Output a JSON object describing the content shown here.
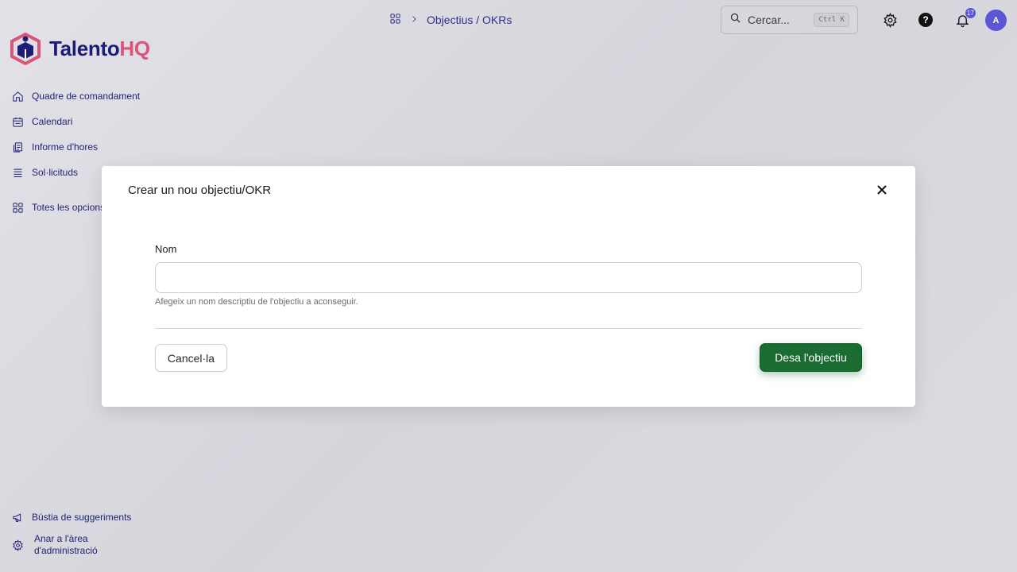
{
  "app": {
    "logo_part1": "Talento",
    "logo_part2": "HQ"
  },
  "breadcrumb": {
    "current": "Objectius / OKRs"
  },
  "search": {
    "placeholder": "Cercar...",
    "shortcut": "Ctrl K"
  },
  "notifications": {
    "count": "17"
  },
  "user": {
    "initial": "A"
  },
  "sidebar": {
    "items": [
      {
        "label": "Quadre de comandament",
        "icon": "home-icon"
      },
      {
        "label": "Calendari",
        "icon": "calendar-icon"
      },
      {
        "label": "Informe d'hores",
        "icon": "report-icon"
      },
      {
        "label": "Sol·licituds",
        "icon": "list-icon"
      },
      {
        "label": "Totes les opcions",
        "icon": "grid-icon"
      }
    ],
    "bottom": [
      {
        "label": "Bústia de suggeriments",
        "icon": "megaphone-icon"
      },
      {
        "label_line1": "Anar a l'àrea",
        "label_line2": "d'administració",
        "icon": "gear-icon"
      }
    ]
  },
  "modal": {
    "title": "Crear un nou objectiu/OKR",
    "field_label": "Nom",
    "field_value": "",
    "field_help": "Afegeix un nom descriptiu de l'objectiu a aconseguir.",
    "cancel_label": "Cancel·la",
    "save_label": "Desa l'objectiu"
  },
  "colors": {
    "brand_dark": "#1e1b7a",
    "brand_pink": "#d9557a",
    "primary_green": "#1b6c33",
    "accent_purple": "#5a56d6"
  }
}
